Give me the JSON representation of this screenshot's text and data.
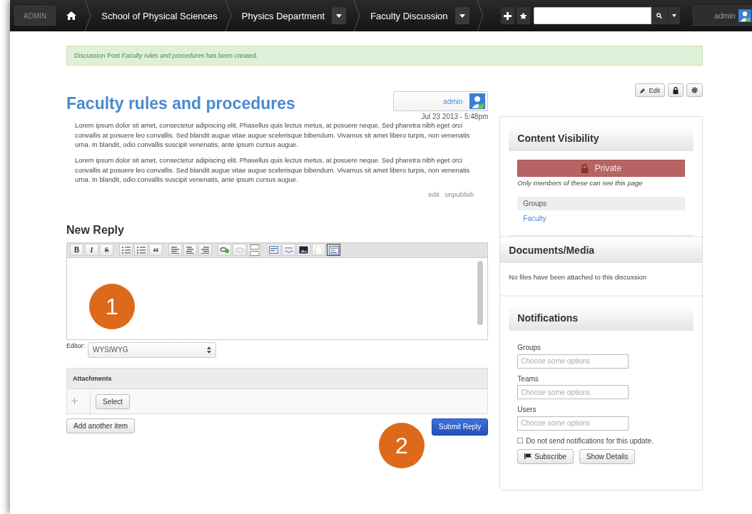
{
  "topbar": {
    "admin_label": "ADMIN",
    "breadcrumbs": [
      {
        "label": "School of Physical Sciences",
        "dropdown": false
      },
      {
        "label": "Physics Department",
        "dropdown": true
      },
      {
        "label": "Faculty Discussion",
        "dropdown": true
      }
    ],
    "user": "admin"
  },
  "flash": "Discussion Post *Faculty rules and procedures* has been created.",
  "post": {
    "title": "Faculty rules and procedures",
    "author": "admin",
    "date": "Jul 23 2013 - 5:48pm",
    "paragraphs": [
      "Lorem ipsum dolor sit amet, consectetur adipiscing elit. Phasellus quis lectus metus, at posuere neque. Sed pharetra nibh eget orci convallis at posuere leo convallis. Sed blandit augue vitae augue scelerisque bibendum. Vivamus sit amet libero turpis, non venenatis urna. In blandit, odio convallis suscipit venenatis, ante ipsum cursus augue.",
      "Lorem ipsum dolor sit amet, consectetur adipiscing elit. Phasellus quis lectus metus, at posuere neque. Sed pharetra nibh eget orci convallis at posuere leo convallis. Sed blandit augue vitae augue scelerisque bibendum. Vivamus sit amet libero turpis, non venenatis urna. In blandit, odio convallis suscipit venenatis, ante ipsum cursus augue."
    ],
    "links": [
      "edit",
      "unpublish"
    ]
  },
  "reply": {
    "heading": "New Reply",
    "toolbar": [
      {
        "kind": "bold",
        "label": "B",
        "selected": false
      },
      {
        "kind": "italic",
        "label": "I",
        "selected": false
      },
      {
        "kind": "strike",
        "label": "S",
        "selected": false
      },
      {
        "kind": "bullets",
        "selected": false
      },
      {
        "kind": "numbers",
        "selected": false
      },
      {
        "kind": "quote",
        "label": "“",
        "selected": false
      },
      {
        "kind": "align-left",
        "selected": false
      },
      {
        "kind": "align-center",
        "selected": false
      },
      {
        "kind": "align-right",
        "selected": false
      },
      {
        "kind": "link",
        "selected": false
      },
      {
        "kind": "unlink",
        "selected": false
      },
      {
        "kind": "page-break",
        "selected": false
      },
      {
        "kind": "template",
        "selected": false
      },
      {
        "kind": "spellcheck",
        "selected": false
      },
      {
        "kind": "image",
        "selected": false
      },
      {
        "kind": "blank",
        "selected": false
      },
      {
        "kind": "source",
        "selected": true
      }
    ],
    "editor_label": "Editor:",
    "editor_value": "WYSIWYG",
    "attachments_title": "Attachments",
    "select_label": "Select",
    "add_label": "Add another item",
    "submit_label": "Submit Reply"
  },
  "callouts": [
    {
      "label": "1"
    },
    {
      "label": "2"
    }
  ],
  "sidebar": {
    "actions": [
      {
        "kind": "edit",
        "label": "Edit"
      },
      {
        "kind": "lock"
      },
      {
        "kind": "gear"
      }
    ],
    "visibility": {
      "title": "Content Visibility",
      "badge": "Private",
      "note": "Only members of these can see this page",
      "groups_heading": "Groups",
      "groups": [
        "Faculty"
      ]
    },
    "documents": {
      "title": "Documents/Media",
      "text": "No files have been attached to this discussion"
    },
    "notifications": {
      "title": "Notifications",
      "fields": [
        {
          "label": "Groups",
          "placeholder": "Choose some options"
        },
        {
          "label": "Teams",
          "placeholder": "Choose some options"
        },
        {
          "label": "Users",
          "placeholder": "Choose some options"
        }
      ],
      "opt_out": {
        "label": "Do not send notifications for this update.",
        "checked": false
      },
      "buttons": [
        {
          "kind": "subscribe",
          "label": "Subscribe"
        },
        {
          "kind": "details",
          "label": "Show Details"
        }
      ]
    }
  }
}
